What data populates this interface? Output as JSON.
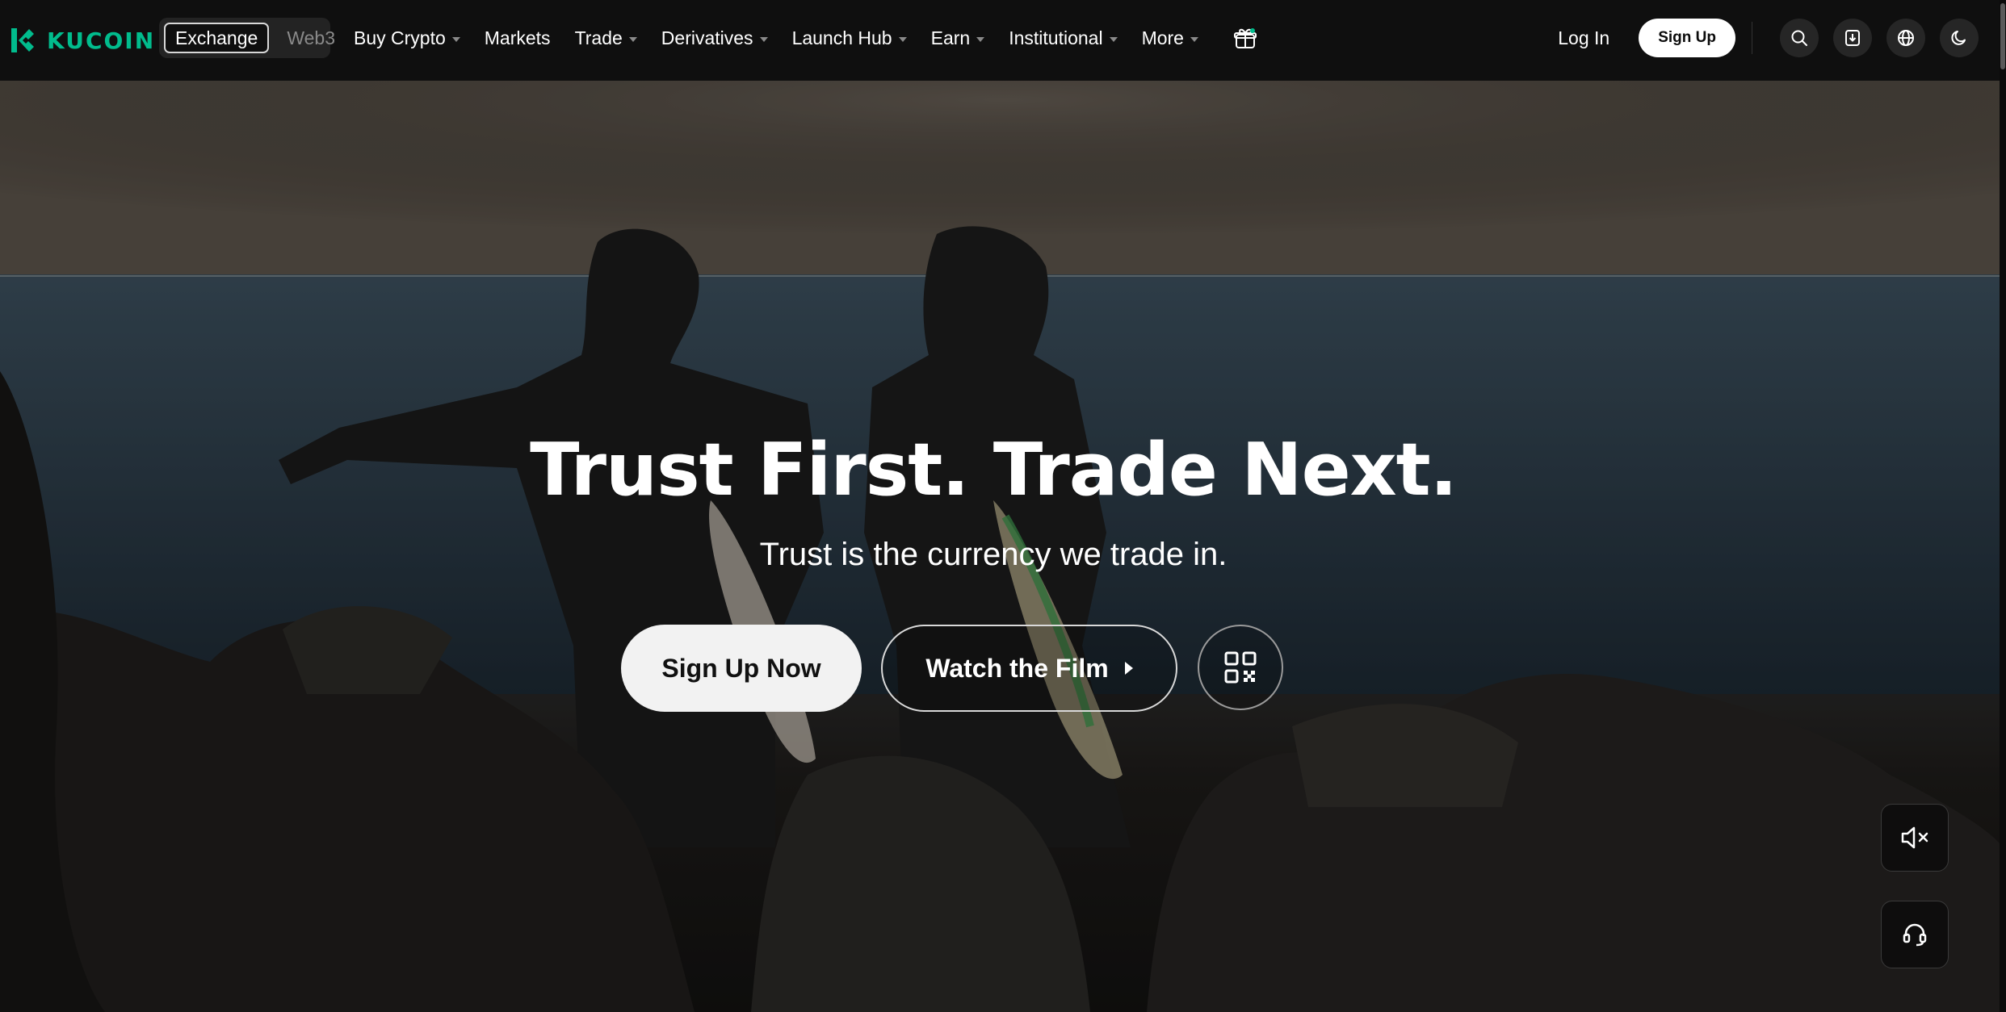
{
  "brand": {
    "name": "KUCOIN",
    "accent": "#01bc8d"
  },
  "switcher": {
    "items": [
      {
        "label": "Exchange",
        "active": true
      },
      {
        "label": "Web3",
        "active": false
      }
    ]
  },
  "nav": {
    "items": [
      {
        "label": "Buy Crypto",
        "dropdown": true
      },
      {
        "label": "Markets",
        "dropdown": false
      },
      {
        "label": "Trade",
        "dropdown": true
      },
      {
        "label": "Derivatives",
        "dropdown": true
      },
      {
        "label": "Launch Hub",
        "dropdown": true
      },
      {
        "label": "Earn",
        "dropdown": true
      },
      {
        "label": "Institutional",
        "dropdown": true
      },
      {
        "label": "More",
        "dropdown": true
      }
    ],
    "gift_icon": "gift-icon"
  },
  "auth": {
    "login_label": "Log In",
    "signup_label": "Sign Up"
  },
  "utility_icons": [
    "search-icon",
    "download-app-icon",
    "globe-icon",
    "theme-moon-icon"
  ],
  "hero": {
    "title": "Trust First. Trade Next.",
    "subtitle": "Trust is the currency we trade in.",
    "primary_cta": "Sign Up Now",
    "secondary_cta": "Watch the Film",
    "qr_icon": "qr-code-icon"
  },
  "floating": {
    "mute_icon": "speaker-muted-icon",
    "support_icon": "headset-support-icon"
  }
}
